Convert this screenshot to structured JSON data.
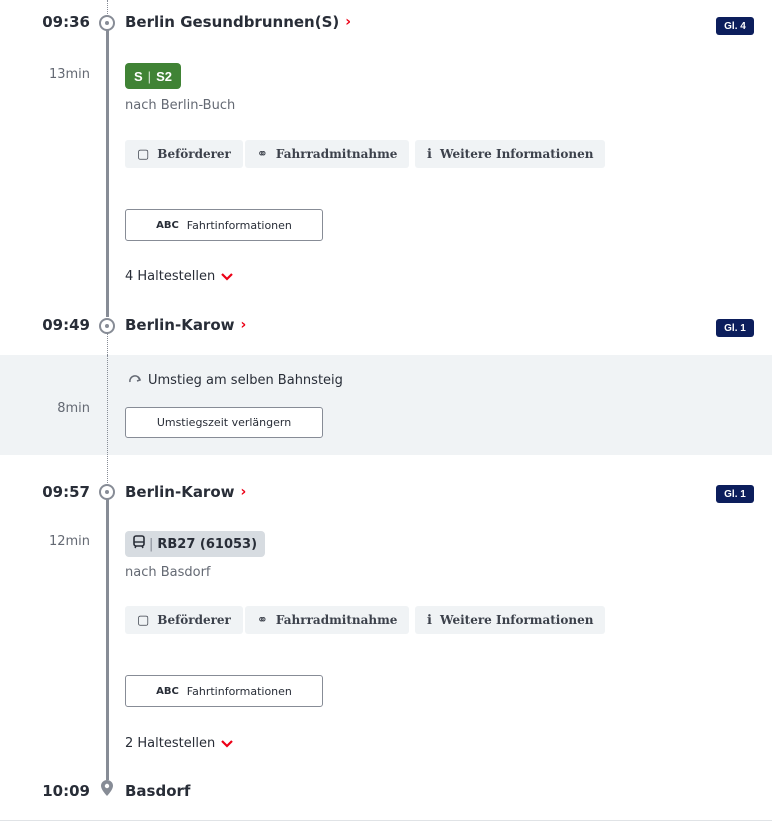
{
  "leg1": {
    "time": "09:36",
    "station": "Berlin Gesundbrunnen(S)",
    "platform": "Gl. 4",
    "duration": "13min",
    "line_type": "S",
    "line_name": "S2",
    "destination": "nach Berlin-Buch",
    "chips": [
      "Beförderer",
      "Fahrradmitnahme",
      "Weitere Informationen"
    ],
    "fahrt_button": "Fahrtinformationen",
    "stops": "4 Haltestellen",
    "arr_time": "09:49",
    "arr_station": "Berlin-Karow",
    "arr_platform": "Gl. 1"
  },
  "transfer": {
    "duration": "8min",
    "text": "Umstieg am selben Bahnsteig",
    "button": "Umstiegszeit verlängern"
  },
  "leg2": {
    "time": "09:57",
    "station": "Berlin-Karow",
    "platform": "Gl. 1",
    "duration": "12min",
    "line_name": "RB27 (61053)",
    "destination": "nach Basdorf",
    "chips": [
      "Beförderer",
      "Fahrradmitnahme",
      "Weitere Informationen"
    ],
    "fahrt_button": "Fahrtinformationen",
    "stops": "2 Haltestellen",
    "arr_time": "10:09",
    "arr_station": "Basdorf"
  },
  "icons": {
    "chevron_right": "›",
    "chevron_down": "⌄",
    "bus": "bus-icon",
    "bike": "bike-icon",
    "info": "info-icon",
    "abc": "ABC",
    "transfer": "transfer-icon"
  },
  "colors": {
    "accent_red": "#ec0016",
    "platform_navy": "#0c1e5c",
    "sbahn_green": "#408335"
  }
}
